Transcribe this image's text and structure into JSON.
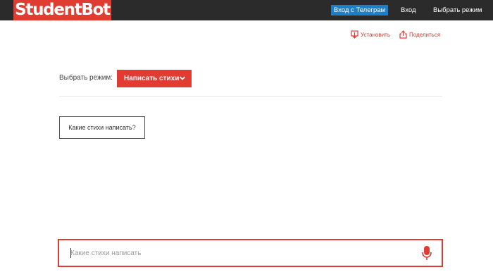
{
  "header": {
    "logo_text": "StudentBot",
    "telegram_login_label": "Вход с Телеграм",
    "login_label": "Вход",
    "select_mode_label": "Выбрать режим"
  },
  "actions": {
    "install_label": "Установить",
    "share_label": "Поделиться"
  },
  "mode": {
    "label": "Выбрать режим:",
    "selected": "Написать стихи"
  },
  "suggestion": {
    "text": "Какие стихи написать?"
  },
  "composer": {
    "placeholder": "Какие стихи написать",
    "value": ""
  },
  "colors": {
    "accent": "#e03c31",
    "topbar": "#2b2b2b",
    "telegram": "#1e7fc9"
  },
  "icons": [
    "install-icon",
    "share-icon",
    "chevron-down-icon",
    "microphone-icon"
  ]
}
